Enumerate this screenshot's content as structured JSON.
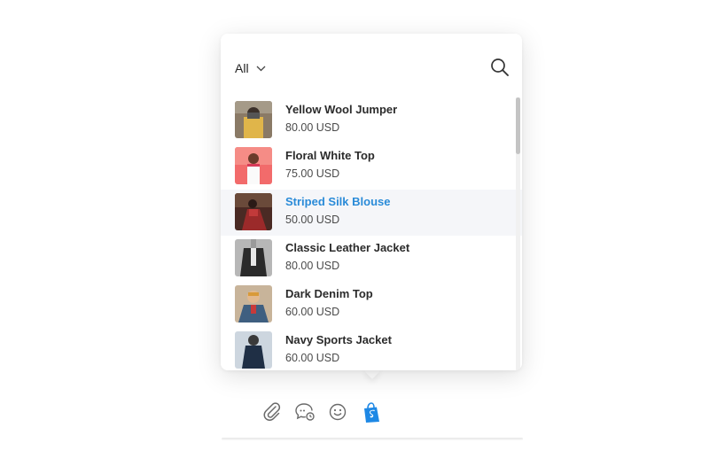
{
  "filter": {
    "label": "All"
  },
  "icons": {
    "filter_chevron": "chevron-down-icon",
    "search": "search-icon",
    "attach": "paperclip-icon",
    "chat": "chat-bubble-icon",
    "emoji": "smiley-icon",
    "shop": "shopify-bag-icon"
  },
  "colors": {
    "accent": "#2a8bd8",
    "shopify": "#1e88e5",
    "active_row": "#f5f6f9"
  },
  "products": [
    {
      "name": "Yellow Wool Jumper",
      "price": "80.00 USD",
      "active": false
    },
    {
      "name": "Floral White Top",
      "price": "75.00 USD",
      "active": false
    },
    {
      "name": "Striped Silk Blouse",
      "price": "50.00 USD",
      "active": true
    },
    {
      "name": "Classic Leather Jacket",
      "price": "80.00 USD",
      "active": false
    },
    {
      "name": "Dark Denim Top",
      "price": "60.00 USD",
      "active": false
    },
    {
      "name": "Navy Sports Jacket",
      "price": "60.00 USD",
      "active": false
    }
  ]
}
